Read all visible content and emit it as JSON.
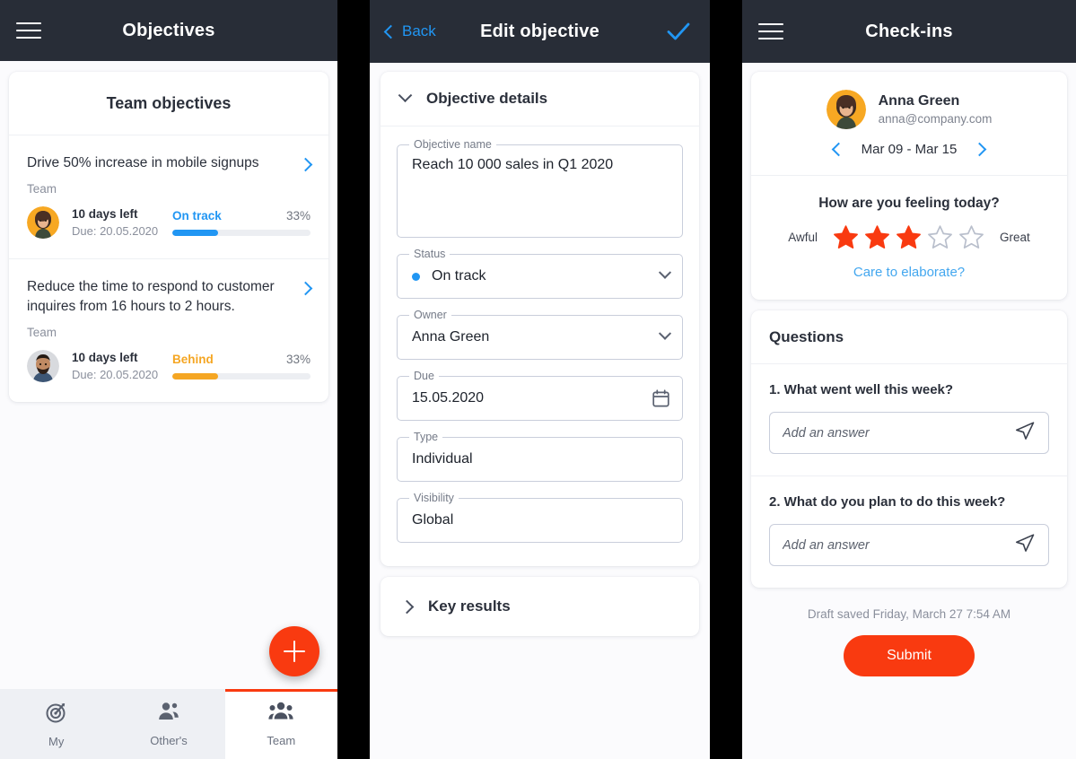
{
  "objectives_screen": {
    "appbar": {
      "title": "Objectives",
      "menu_icon": "hamburger-menu-icon"
    },
    "card_title": "Team objectives",
    "items": [
      {
        "title": "Drive 50% increase in mobile signups",
        "scope": "Team",
        "days_left": "10 days left",
        "due": "Due: 20.05.2020",
        "status": "On track",
        "status_color": "#2196f3",
        "percent": "33%",
        "progress": 33,
        "avatar": "woman-avatar"
      },
      {
        "title": "Reduce the time to respond to customer inquires from 16 hours to 2 hours.",
        "scope": "Team",
        "days_left": "10 days left",
        "due": "Due: 20.05.2020",
        "status": "Behind",
        "status_color": "#f5a623",
        "percent": "33%",
        "progress": 33,
        "avatar": "man-avatar"
      }
    ],
    "fab_label": "add-objective",
    "bottom_nav": [
      {
        "label": "My",
        "icon": "target-icon",
        "active": false
      },
      {
        "label": "Other's",
        "icon": "person-pair-icon",
        "active": false
      },
      {
        "label": "Team",
        "icon": "people-group-icon",
        "active": true
      }
    ],
    "accent_color": "#f93a10"
  },
  "edit_objective_screen": {
    "appbar": {
      "back_label": "Back",
      "title": "Edit objective",
      "confirm_icon": "checkmark-icon"
    },
    "details_section": {
      "title": "Objective details",
      "expanded": true
    },
    "fields": [
      {
        "label": "Objective name",
        "value": "Reach 10 000 sales in Q1 2020",
        "control": "none",
        "tall": true
      },
      {
        "label": "Status",
        "value": "On track",
        "control": "chevron-down-icon",
        "dot": "#2196f3"
      },
      {
        "label": "Owner",
        "value": "Anna Green",
        "control": "chevron-down-icon"
      },
      {
        "label": "Due",
        "value": "15.05.2020",
        "control": "calendar-icon"
      },
      {
        "label": "Type",
        "value": "Individual",
        "control": "none"
      },
      {
        "label": "Visibility",
        "value": "Global",
        "control": "none"
      }
    ],
    "key_results_section": {
      "title": "Key results",
      "expanded": false
    }
  },
  "checkins_screen": {
    "appbar": {
      "title": "Check-ins",
      "menu_icon": "hamburger-menu-icon"
    },
    "user": {
      "name": "Anna Green",
      "email": "anna@company.com",
      "avatar": "woman-avatar"
    },
    "week_range": "Mar 09 - Mar 15",
    "mood": {
      "question": "How are you feeling today?",
      "low_label": "Awful",
      "high_label": "Great",
      "rating": 3,
      "max": 5,
      "star_color": "#f93a10",
      "elaborate_link": "Care to elaborate?"
    },
    "questions_title": "Questions",
    "questions": [
      {
        "text": "1. What went well this week?",
        "answer": "",
        "placeholder": "Add an answer",
        "send_icon": "send-icon"
      },
      {
        "text": "2. What do you plan to do this week?",
        "answer": "",
        "placeholder": "Add an answer",
        "send_icon": "send-icon"
      }
    ],
    "draft_status": "Draft saved Friday, March 27 7:54 AM",
    "submit_label": "Submit"
  }
}
